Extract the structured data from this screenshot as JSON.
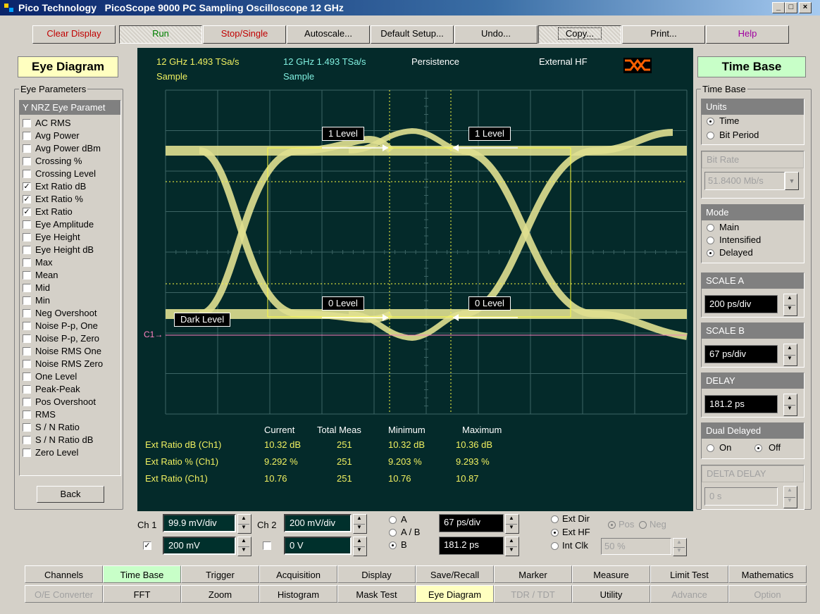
{
  "window": {
    "vendor": "Pico Technology",
    "title": "PicoScope 9000   PC Sampling Oscilloscope 12 GHz",
    "min": "_",
    "max": "□",
    "close": "×"
  },
  "toolbar": {
    "clear": "Clear Display",
    "run": "Run",
    "stop": "Stop/Single",
    "autoscale": "Autoscale...",
    "default_setup": "Default Setup...",
    "undo": "Undo...",
    "copy": "Copy...",
    "print": "Print...",
    "help": "Help"
  },
  "left": {
    "heading": "Eye Diagram",
    "group_label": "Eye Parameters",
    "list_header": "Y NRZ Eye Paramet",
    "items": [
      {
        "label": "AC RMS",
        "checked": false
      },
      {
        "label": "Avg Power",
        "checked": false
      },
      {
        "label": "Avg Power dBm",
        "checked": false
      },
      {
        "label": "Crossing %",
        "checked": false
      },
      {
        "label": "Crossing Level",
        "checked": false
      },
      {
        "label": "Ext Ratio dB",
        "checked": true
      },
      {
        "label": "Ext Ratio %",
        "checked": true
      },
      {
        "label": "Ext Ratio",
        "checked": true
      },
      {
        "label": "Eye Amplitude",
        "checked": false
      },
      {
        "label": "Eye Height",
        "checked": false
      },
      {
        "label": "Eye Height dB",
        "checked": false
      },
      {
        "label": "Max",
        "checked": false
      },
      {
        "label": "Mean",
        "checked": false
      },
      {
        "label": "Mid",
        "checked": false
      },
      {
        "label": "Min",
        "checked": false
      },
      {
        "label": "Neg Overshoot",
        "checked": false
      },
      {
        "label": "Noise P-p, One",
        "checked": false
      },
      {
        "label": "Noise P-p, Zero",
        "checked": false
      },
      {
        "label": "Noise RMS One",
        "checked": false
      },
      {
        "label": "Noise RMS Zero",
        "checked": false
      },
      {
        "label": "One Level",
        "checked": false
      },
      {
        "label": "Peak-Peak",
        "checked": false
      },
      {
        "label": "Pos Overshoot",
        "checked": false
      },
      {
        "label": "RMS",
        "checked": false
      },
      {
        "label": "S / N Ratio",
        "checked": false
      },
      {
        "label": "S / N Ratio dB",
        "checked": false
      },
      {
        "label": "Zero Level",
        "checked": false
      }
    ],
    "back": "Back",
    "check_mark": "✓"
  },
  "scope": {
    "ch1_line1": "12 GHz  1.493 TSa/s",
    "ch1_line2": "Sample",
    "ch2_line1": "12 GHz  1.493 TSa/s",
    "ch2_line2": "Sample",
    "persistence": "Persistence",
    "trigger": "External HF",
    "level_one_a": "1 Level",
    "level_one_b": "1 Level",
    "level_zero_a": "0 Level",
    "level_zero_b": "0 Level",
    "dark_level": "Dark Level",
    "c1_marker": "C1",
    "colors": {
      "background": "#042a2a",
      "trace": "#e0e090",
      "grid": "#3c6464",
      "window": "#ffff40",
      "c1_line": "#ff80c0"
    },
    "meas_headers": [
      "Current",
      "Total Meas",
      "Minimum",
      "Maximum"
    ],
    "meas_rows": [
      {
        "name": "Ext Ratio dB (Ch1)",
        "current": "10.32 dB",
        "total": "251",
        "min": "10.32 dB",
        "max": "10.36 dB"
      },
      {
        "name": "Ext Ratio % (Ch1)",
        "current": "9.292 %",
        "total": "251",
        "min": "9.203 %",
        "max": "9.293 %"
      },
      {
        "name": "Ext Ratio (Ch1)",
        "current": "10.76",
        "total": "251",
        "min": "10.76",
        "max": "10.87"
      }
    ]
  },
  "controls": {
    "ch1_label": "Ch 1",
    "ch1_scale": "99.9 mV/div",
    "ch1_offset": "200 mV",
    "ch1_checked": true,
    "ch2_label": "Ch 2",
    "ch2_scale": "200 mV/div",
    "ch2_offset": "0 V",
    "ch2_checked": false,
    "tb_a": "A",
    "tb_ab": "A / B",
    "tb_b": "B",
    "tb_scale": "67 ps/div",
    "tb_delay": "181.2 ps",
    "trig_extdir": "Ext Dir",
    "trig_exthf": "Ext HF",
    "trig_intclk": "Int Clk",
    "pos": "Pos",
    "neg": "Neg",
    "level": "50 %"
  },
  "right": {
    "heading": "Time Base",
    "group_label": "Time Base",
    "units_hdr": "Units",
    "units_time": "Time",
    "units_bit": "Bit Period",
    "bitrate_hdr": "Bit Rate",
    "bitrate_val": "51.8400 Mb/s",
    "mode_hdr": "Mode",
    "mode_main": "Main",
    "mode_int": "Intensified",
    "mode_delayed": "Delayed",
    "scale_a_hdr": "SCALE A",
    "scale_a": "200 ps/div",
    "scale_b_hdr": "SCALE B",
    "scale_b": "67 ps/div",
    "delay_hdr": "DELAY",
    "delay": "181.2 ps",
    "dual_hdr": "Dual Delayed",
    "dual_on": "On",
    "dual_off": "Off",
    "delta_hdr": "DELTA DELAY",
    "delta": "0 s"
  },
  "tabs_row1": [
    "Channels",
    "Time Base",
    "Trigger",
    "Acquisition",
    "Display",
    "Save/Recall",
    "Marker",
    "Measure",
    "Limit Test",
    "Mathematics"
  ],
  "tabs_row2": [
    "O/E Converter",
    "FFT",
    "Zoom",
    "Histogram",
    "Mask Test",
    "Eye Diagram",
    "TDR / TDT",
    "Utility",
    "Advance",
    "Option"
  ]
}
